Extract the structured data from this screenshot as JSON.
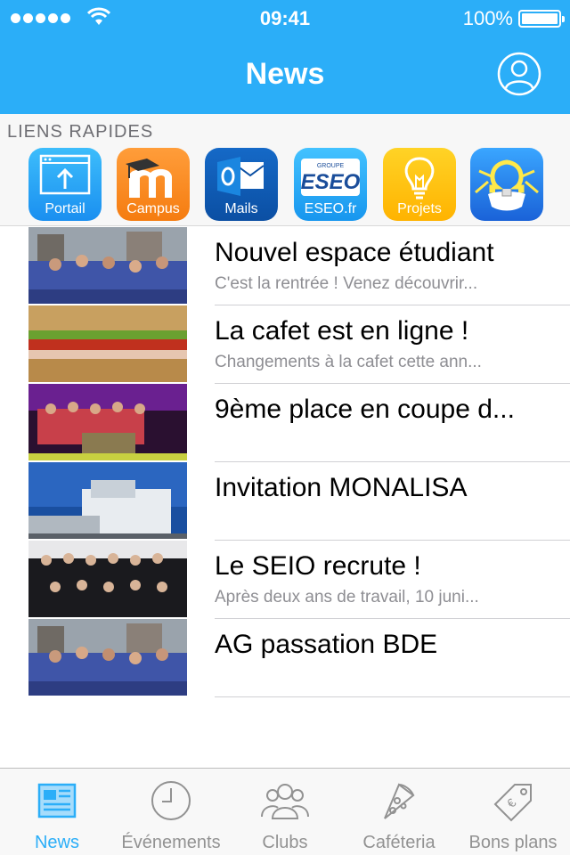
{
  "status_bar": {
    "time": "09:41",
    "battery": "100%"
  },
  "header": {
    "title": "News"
  },
  "quick_links": {
    "title": "LIENS RAPIDES",
    "apps": [
      {
        "label": "Portail",
        "icon": "portal-icon"
      },
      {
        "label": "Campus",
        "icon": "moodle-icon"
      },
      {
        "label": "Mails",
        "icon": "outlook-icon"
      },
      {
        "label": "ESEO.fr",
        "icon": "eseo-logo-icon"
      },
      {
        "label": "Projets",
        "icon": "lightbulb-icon"
      },
      {
        "label": "",
        "icon": "omega-icon"
      }
    ]
  },
  "news": [
    {
      "title": "Nouvel espace étudiant",
      "subtitle": "C'est la rentrée ! Venez découvrir..."
    },
    {
      "title": "La cafet est en ligne !",
      "subtitle": "Changements à la cafet cette ann..."
    },
    {
      "title": "9ème place en coupe d...",
      "subtitle": ""
    },
    {
      "title": "Invitation MONALISA",
      "subtitle": ""
    },
    {
      "title": "Le SEIO recrute !",
      "subtitle": "Après deux ans de travail, 10 juni..."
    },
    {
      "title": "AG passation BDE",
      "subtitle": ""
    }
  ],
  "tabs": [
    {
      "label": "News",
      "icon": "newspaper-icon",
      "active": true
    },
    {
      "label": "Événements",
      "icon": "clock-icon",
      "active": false
    },
    {
      "label": "Clubs",
      "icon": "group-icon",
      "active": false
    },
    {
      "label": "Caféteria",
      "icon": "pizza-icon",
      "active": false
    },
    {
      "label": "Bons plans",
      "icon": "tag-icon",
      "active": false
    }
  ],
  "colors": {
    "accent": "#2baef8",
    "inactive": "#929292"
  }
}
